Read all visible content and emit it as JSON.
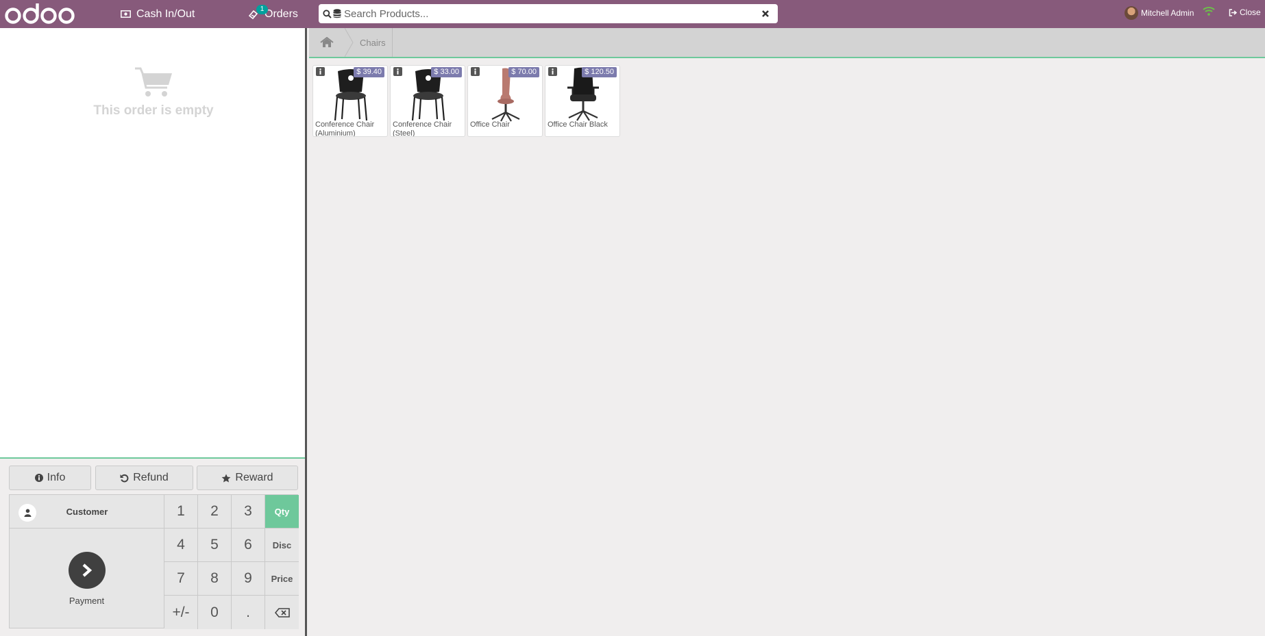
{
  "topbar": {
    "logo_text": "odoo",
    "cash_label": "Cash In/Out",
    "orders_label": "Orders",
    "orders_badge": "1",
    "search_placeholder": "Search Products...",
    "user_name": "Mitchell Admin",
    "close_label": "Close"
  },
  "order": {
    "empty_text": "This order is empty"
  },
  "controls": {
    "info_label": "Info",
    "refund_label": "Refund",
    "reward_label": "Reward",
    "customer_label": "Customer",
    "payment_label": "Payment"
  },
  "numpad": {
    "keys": [
      "1",
      "2",
      "3",
      "4",
      "5",
      "6",
      "7",
      "8",
      "9",
      "+/-",
      "0",
      "."
    ],
    "modes": [
      "Qty",
      "Disc",
      "Price"
    ],
    "active_mode": "Qty"
  },
  "breadcrumb": {
    "category": "Chairs"
  },
  "products": [
    {
      "name": "Conference Chair (Aluminium)",
      "price": "$ 39.40"
    },
    {
      "name": "Conference Chair (Steel)",
      "price": "$ 33.00"
    },
    {
      "name": "Office Chair",
      "price": "$ 70.00"
    },
    {
      "name": "Office Chair Black",
      "price": "$ 120.50"
    }
  ],
  "colors": {
    "brand": "#875a7b",
    "accent": "#6ec89b",
    "price_badge": "#7c7bad",
    "online": "#6cc04a"
  },
  "icons": [
    "cash-icon",
    "orders-icon",
    "search-icon",
    "database-icon",
    "clear-icon",
    "wifi-icon",
    "sign-out-icon",
    "cart-icon",
    "info-icon",
    "undo-icon",
    "star-icon",
    "user-icon",
    "chevron-right-icon",
    "backspace-icon",
    "home-icon"
  ]
}
